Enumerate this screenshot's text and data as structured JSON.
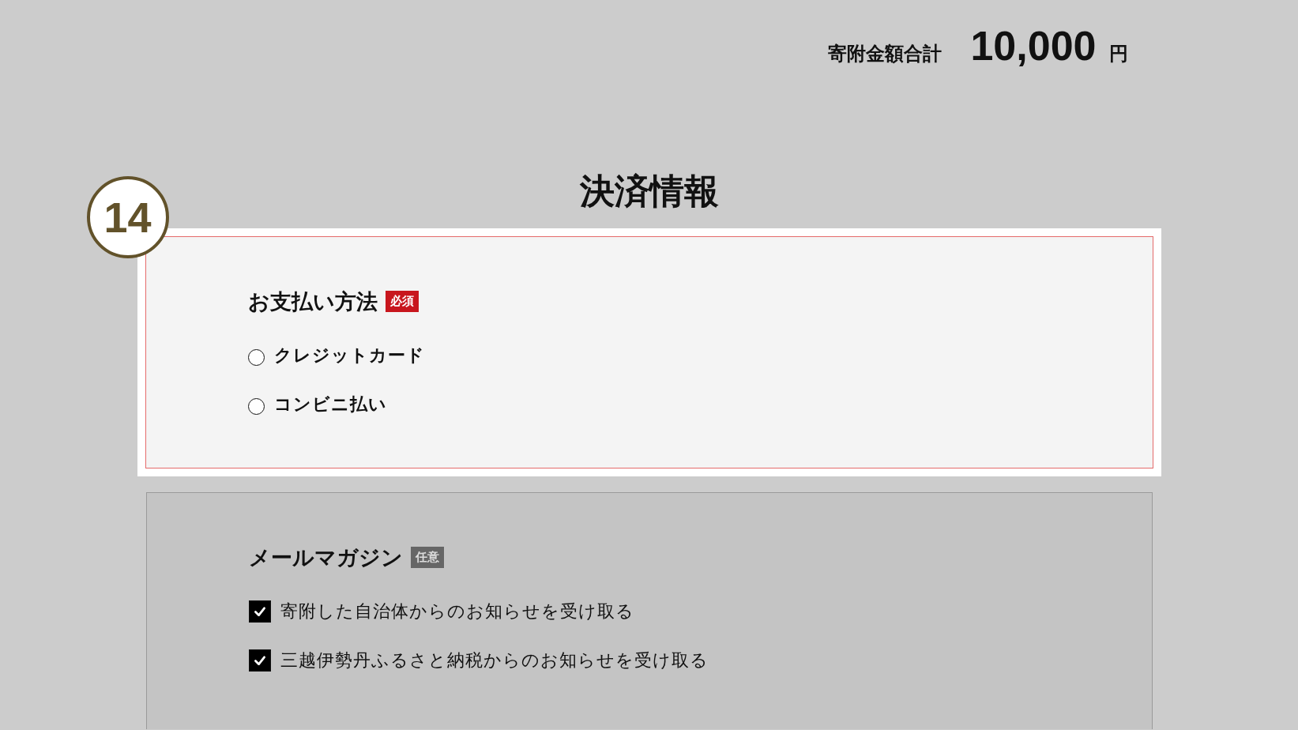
{
  "total": {
    "label": "寄附金額合計",
    "amount": "10,000",
    "unit": "円"
  },
  "title": "決済情報",
  "step_marker": "14",
  "sections": [
    {
      "kind": "radio",
      "highlighted": true,
      "heading": "お支払い方法",
      "badge": {
        "text": "必須",
        "required": true
      },
      "options": [
        {
          "label": "クレジットカード",
          "selected": false
        },
        {
          "label": "コンビニ払い",
          "selected": false
        }
      ]
    },
    {
      "kind": "checkbox",
      "highlighted": false,
      "heading": "メールマガジン",
      "badge": {
        "text": "任意",
        "required": false
      },
      "options": [
        {
          "label": "寄附した自治体からのお知らせを受け取る",
          "checked": true
        },
        {
          "label": "三越伊勢丹ふるさと納税からのお知らせを受け取る",
          "checked": true
        }
      ]
    }
  ]
}
